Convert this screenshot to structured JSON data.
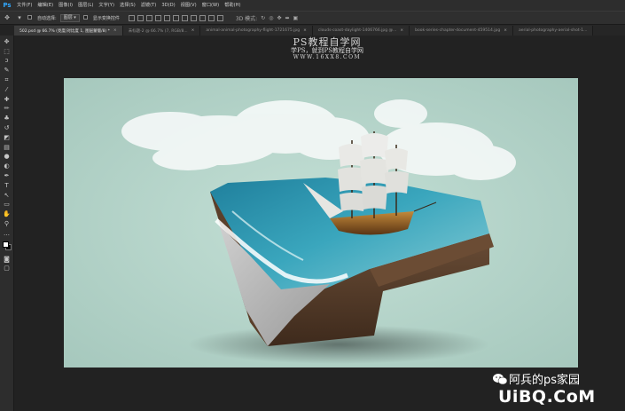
{
  "menu": {
    "logo": "Ps",
    "items": [
      "文件(F)",
      "编辑(E)",
      "图像(I)",
      "图层(L)",
      "文字(Y)",
      "选择(S)",
      "滤镜(T)",
      "3D(D)",
      "视图(V)",
      "窗口(W)",
      "帮助(H)"
    ]
  },
  "options": {
    "auto_select_label": "自动选择:",
    "auto_select_value": "图层",
    "show_transform_label": "显示变换控件",
    "mode_3d_label": "3D 模式:"
  },
  "tabs": [
    {
      "label": "502.psd @ 66.7% (亮度/对比度 1, 图层蒙版/8) *",
      "close": "×",
      "active": true
    },
    {
      "label": "未标题-2 @ 66.7% (7, RGB/8...",
      "close": "×",
      "active": false
    },
    {
      "label": "animal-animal-photography-flight-1721675.jpg",
      "close": "×",
      "active": false
    },
    {
      "label": "clouds-coast-daylight-1406766.jpg @...",
      "close": "×",
      "active": false
    },
    {
      "label": "book-series-chapter-document-459514.jpg",
      "close": "×",
      "active": false
    },
    {
      "label": "aerial-photography-aerial-shot-1...",
      "close": "",
      "active": false
    }
  ],
  "tools": [
    "move-icon",
    "marquee-icon",
    "lasso-icon",
    "quick-select-icon",
    "crop-icon",
    "eyedropper-icon",
    "healing-icon",
    "brush-icon",
    "stamp-icon",
    "history-brush-icon",
    "eraser-icon",
    "gradient-icon",
    "blur-icon",
    "dodge-icon",
    "pen-icon",
    "type-icon",
    "path-select-icon",
    "shape-icon",
    "hand-icon",
    "zoom-icon",
    "more-icon"
  ],
  "tool_glyphs": [
    "✥",
    "⬚",
    "ↄ",
    "✎",
    "⌗",
    "⁄",
    "✚",
    "✏",
    "♣",
    "↺",
    "◩",
    "▤",
    "●",
    "◐",
    "✒",
    "T",
    "↖",
    "▭",
    "✋",
    "⚲",
    "…"
  ],
  "colors": {
    "foreground": "#ffffff",
    "background": "#000000",
    "canvas_bg": "#b2d2c8"
  },
  "watermark_top": {
    "title": "PS教程自学网",
    "subtitle": "学PS，就到PS教程自学网",
    "url": "WWW.16XX8.COM"
  },
  "watermark_bottom": {
    "name": "阿兵的ps家园",
    "site": "UiBQ.CoM"
  }
}
